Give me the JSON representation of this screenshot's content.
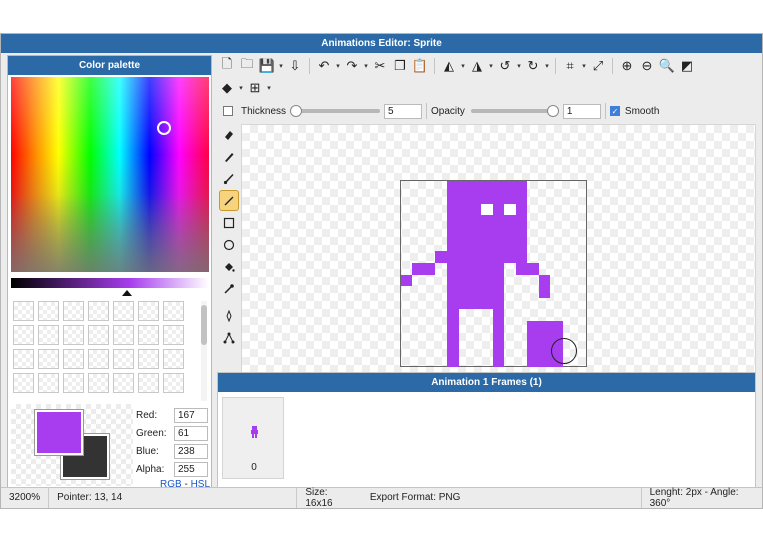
{
  "window": {
    "title": "Animations Editor: Sprite"
  },
  "palette": {
    "title": "Color palette",
    "foreground_color": "#a73dee",
    "background_color": "#333333",
    "red_label": "Red:",
    "red": "167",
    "green_label": "Green:",
    "green": "61",
    "blue_label": "Blue:",
    "blue": "238",
    "alpha_label": "Alpha:",
    "alpha": "255",
    "mode_rgb": "RGB",
    "mode_sep": " - ",
    "mode_hsl": "HSL"
  },
  "options": {
    "thickness_label": "Thickness",
    "thickness_value": "5",
    "opacity_label": "Opacity",
    "opacity_value": "1",
    "smooth_label": "Smooth"
  },
  "frames": {
    "title": "Animation 1 Frames (1)",
    "items": [
      {
        "number": "0"
      }
    ]
  },
  "status": {
    "zoom": "3200%",
    "pointer": "Pointer: 13, 14",
    "size": "Size: 16x16",
    "format": "Export Format: PNG",
    "length_angle": "Lenght: 2px - Angle: 360°"
  },
  "icons": {
    "new": "🗋",
    "open": "🗀",
    "save": "💾",
    "export": "⇩",
    "undo": "↶",
    "redo": "↷",
    "cut": "✂",
    "copy": "❐",
    "paste": "📋",
    "flip_h": "◭",
    "flip_v": "◮",
    "rotate_ccw": "↺",
    "rotate_cw": "↻",
    "crop": "⌗",
    "resize": "⤢",
    "zoom_in": "⊕",
    "zoom_out": "⊖",
    "zoom_fit": "🔍",
    "invert": "◩",
    "layers": "◆",
    "grid": "⊞"
  }
}
